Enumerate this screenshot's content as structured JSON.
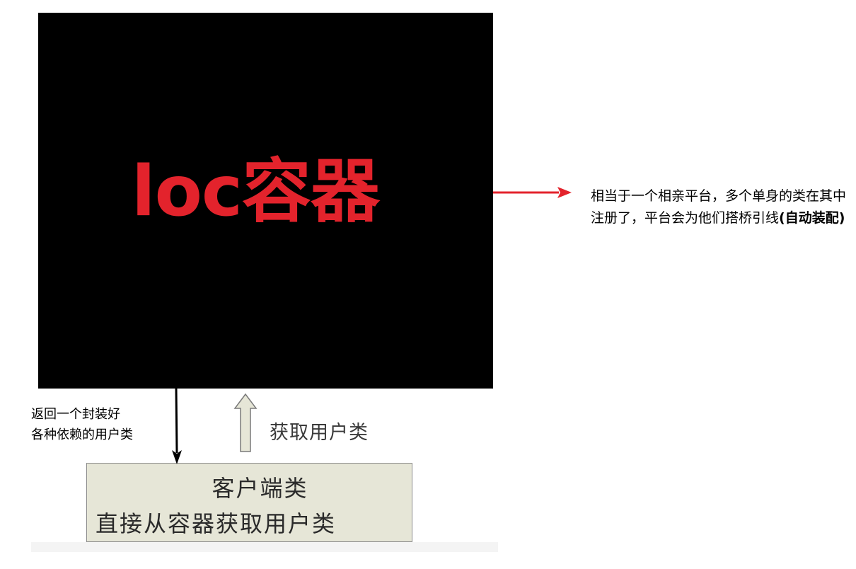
{
  "ioc": {
    "title": "loc容器"
  },
  "note": {
    "text": "相当于一个相亲平台，多个单身的类在其中注册了，平台会为他们搭桥引线",
    "bold_text": "(自动装配)"
  },
  "return_note": {
    "line1": "返回一个封装好",
    "line2": "各种依赖的用户类"
  },
  "get_label": "获取用户类",
  "client": {
    "title": "客户端类",
    "description": "直接从容器获取用户类"
  },
  "colors": {
    "ioc_background": "#000000",
    "ioc_title": "#e3232c",
    "arrow_red": "#e3232c",
    "client_fill": "#e6e6d7",
    "hollow_arrow_fill": "#e6e6d7"
  }
}
